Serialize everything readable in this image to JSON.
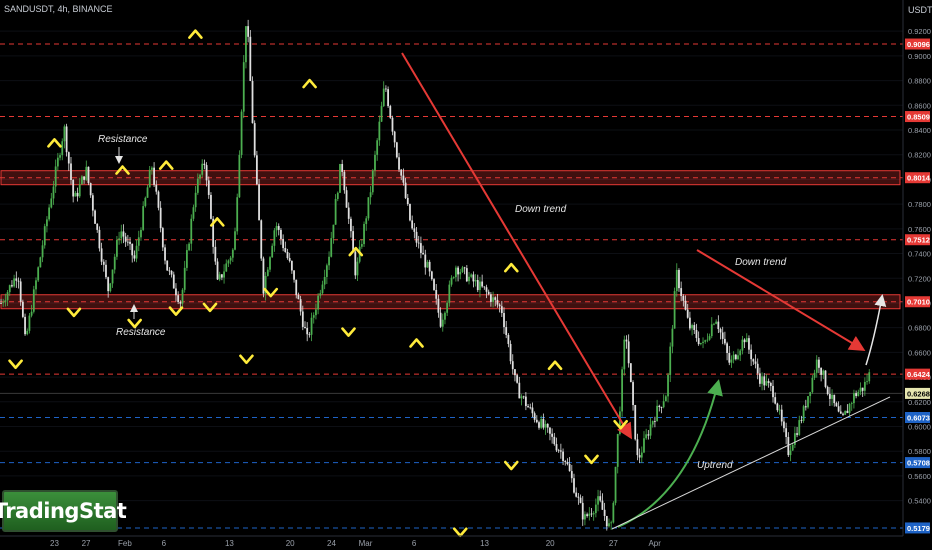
{
  "header": {
    "symbol_line": "SANDUSDT, 4h, BINANCE",
    "currency": "USDT"
  },
  "logo": {
    "text": "TradingStat"
  },
  "colors": {
    "background": "#000000",
    "candle_up": "#4caf50",
    "candle_down": "#e0e0e0",
    "resistance_line": "#e53935",
    "support_line": "#1e63c6",
    "zone_border": "#e53935",
    "arrow_down_trend": "#e53935",
    "arrow_up_trend": "#4caf50",
    "marker": "#ffeb3b",
    "trendline": "#d8d8d8"
  },
  "annotations": {
    "resistance_top": "Resistance",
    "resistance_bottom": "Resistance",
    "down_trend_1": "Down trend",
    "down_trend_2": "Down trend",
    "uptrend": "Uptrend"
  },
  "chart_data": {
    "type": "candlestick",
    "title": "SANDUSDT, 4h, BINANCE",
    "ylim": [
      0.513,
      0.942
    ],
    "y_ticks": [
      "0.9200",
      "0.9000",
      "0.8800",
      "0.8600",
      "0.8400",
      "0.8200",
      "0.8000",
      "0.7800",
      "0.7600",
      "0.7400",
      "0.7200",
      "0.7000",
      "0.6800",
      "0.6600",
      "0.6400",
      "0.6200",
      "0.6000",
      "0.5800",
      "0.5600",
      "0.5400"
    ],
    "x_ticks": [
      "23",
      "27",
      "Feb",
      "6",
      "13",
      "20",
      "24",
      "Mar",
      "6",
      "13",
      "20",
      "27",
      "Apr"
    ],
    "levels": [
      {
        "price": 0.9096,
        "label": "0.9096",
        "style": "resistance"
      },
      {
        "price": 0.8509,
        "label": "0.8509",
        "style": "resistance"
      },
      {
        "price": 0.8014,
        "label": "0.8014",
        "style": "resistance-zone"
      },
      {
        "price": 0.7512,
        "label": "0.7512",
        "style": "resistance"
      },
      {
        "price": 0.701,
        "label": "0.7010",
        "style": "resistance-zone"
      },
      {
        "price": 0.6424,
        "label": "0.6424",
        "style": "resistance"
      },
      {
        "price": 0.6268,
        "label": "0.6268",
        "style": "last-price"
      },
      {
        "price": 0.6073,
        "label": "0.6073",
        "style": "support"
      },
      {
        "price": 0.5708,
        "label": "0.5708",
        "style": "support"
      },
      {
        "price": 0.5179,
        "label": "0.5179",
        "style": "support"
      }
    ],
    "last_price": 0.6268,
    "price_path": [
      [
        0.0,
        0.7
      ],
      [
        0.7,
        0.725
      ],
      [
        1.0,
        0.668
      ],
      [
        2.0,
        0.78
      ],
      [
        2.6,
        0.842
      ],
      [
        3.0,
        0.782
      ],
      [
        3.5,
        0.808
      ],
      [
        4.4,
        0.71
      ],
      [
        4.9,
        0.76
      ],
      [
        5.5,
        0.735
      ],
      [
        6.2,
        0.812
      ],
      [
        6.8,
        0.73
      ],
      [
        7.4,
        0.7
      ],
      [
        8.0,
        0.792
      ],
      [
        8.4,
        0.815
      ],
      [
        8.9,
        0.715
      ],
      [
        9.6,
        0.745
      ],
      [
        10.1,
        0.935
      ],
      [
        10.4,
        0.83
      ],
      [
        10.8,
        0.712
      ],
      [
        11.3,
        0.765
      ],
      [
        11.9,
        0.73
      ],
      [
        12.6,
        0.67
      ],
      [
        13.5,
        0.74
      ],
      [
        14.0,
        0.815
      ],
      [
        14.6,
        0.723
      ],
      [
        15.2,
        0.79
      ],
      [
        15.8,
        0.878
      ],
      [
        16.3,
        0.82
      ],
      [
        16.9,
        0.76
      ],
      [
        17.6,
        0.726
      ],
      [
        18.1,
        0.684
      ],
      [
        18.7,
        0.73
      ],
      [
        19.4,
        0.718
      ],
      [
        19.9,
        0.71
      ],
      [
        20.6,
        0.695
      ],
      [
        21.2,
        0.632
      ],
      [
        21.8,
        0.612
      ],
      [
        22.5,
        0.595
      ],
      [
        23.2,
        0.575
      ],
      [
        24.0,
        0.525
      ],
      [
        24.6,
        0.54
      ],
      [
        25.1,
        0.515
      ],
      [
        25.7,
        0.68
      ],
      [
        26.2,
        0.572
      ],
      [
        26.8,
        0.605
      ],
      [
        27.4,
        0.628
      ],
      [
        27.8,
        0.724
      ],
      [
        28.3,
        0.682
      ],
      [
        28.9,
        0.665
      ],
      [
        29.4,
        0.69
      ],
      [
        30.0,
        0.65
      ],
      [
        30.6,
        0.672
      ],
      [
        31.2,
        0.64
      ],
      [
        31.8,
        0.628
      ],
      [
        32.4,
        0.58
      ],
      [
        33.0,
        0.61
      ],
      [
        33.6,
        0.655
      ],
      [
        34.1,
        0.625
      ],
      [
        34.6,
        0.604
      ],
      [
        35.1,
        0.625
      ],
      [
        35.5,
        0.632
      ],
      [
        35.8,
        0.645
      ]
    ],
    "x_tick_positions": [
      2.2,
      3.5,
      5.1,
      6.7,
      9.4,
      11.9,
      13.6,
      15.0,
      17.0,
      19.9,
      22.6,
      25.2,
      26.9
    ]
  },
  "markers": {
    "peaks": [
      [
        2.2,
        0.83
      ],
      [
        5.0,
        0.808
      ],
      [
        6.8,
        0.812
      ],
      [
        8.0,
        0.918
      ],
      [
        8.9,
        0.766
      ],
      [
        12.7,
        0.878
      ],
      [
        14.6,
        0.742
      ],
      [
        17.1,
        0.668
      ],
      [
        21.0,
        0.729
      ],
      [
        22.8,
        0.65
      ]
    ],
    "troughs": [
      [
        0.6,
        0.65
      ],
      [
        3.0,
        0.692
      ],
      [
        5.5,
        0.683
      ],
      [
        7.2,
        0.693
      ],
      [
        8.6,
        0.696
      ],
      [
        10.1,
        0.654
      ],
      [
        11.1,
        0.708
      ],
      [
        14.3,
        0.676
      ],
      [
        18.9,
        0.514
      ],
      [
        21.0,
        0.568
      ],
      [
        24.3,
        0.573
      ],
      [
        25.5,
        0.601
      ]
    ],
    "level_tag_prices": [
      0.9096,
      0.8509,
      0.8014,
      0.7512,
      0.701,
      0.6424,
      0.6268,
      0.6073,
      0.5708,
      0.5179
    ]
  }
}
